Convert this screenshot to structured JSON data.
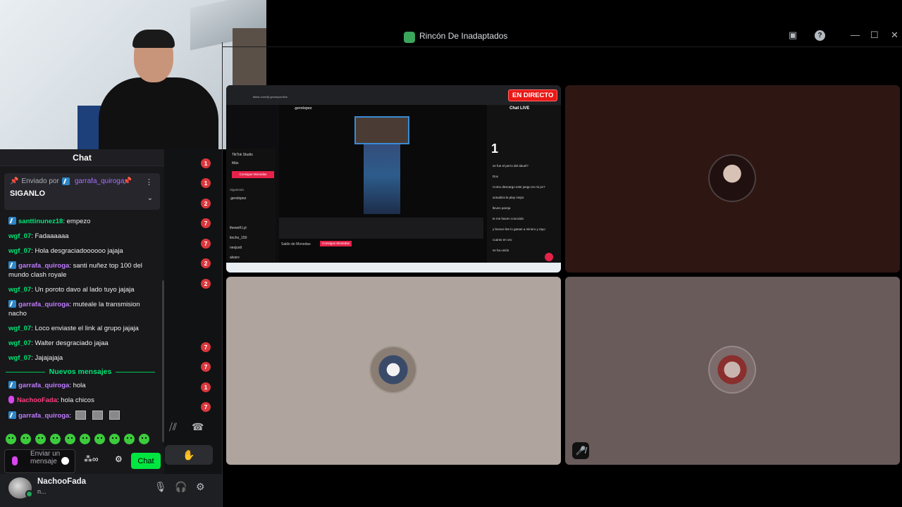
{
  "window": {
    "server_name": "Rincón De Inadaptados"
  },
  "chat": {
    "title": "Chat",
    "pinned": {
      "sent_by_label": "Enviado por",
      "user": "garrafa_quiroga",
      "message": "SIGANLO"
    },
    "messages": [
      {
        "badge": true,
        "user": "santtinunez18",
        "color": "#00e676",
        "text": ": empezo"
      },
      {
        "badge": false,
        "user": "wgf_07",
        "color": "#00e676",
        "text": ": Fadaaaaaa"
      },
      {
        "badge": false,
        "user": "wgf_07",
        "color": "#00e676",
        "text": ": Hola desgraciadoooooo jajaja"
      },
      {
        "badge": true,
        "user": "garrafa_quiroga",
        "color": "#bf7bff",
        "text": ": santi nuñez top 100 del mundo clash royale"
      },
      {
        "badge": false,
        "user": "wgf_07",
        "color": "#00e676",
        "text": ": Un poroto davo al lado tuyo jajaja"
      },
      {
        "badge": true,
        "user": "garrafa_quiroga",
        "color": "#bf7bff",
        "text": ": muteale la transmision nacho"
      },
      {
        "badge": false,
        "user": "wgf_07",
        "color": "#00e676",
        "text": ": Loco enviaste el link al grupo jajaja"
      },
      {
        "badge": false,
        "user": "wgf_07",
        "color": "#00e676",
        "text": ": Walter desgraciado jajaa"
      },
      {
        "badge": false,
        "user": "wgf_07",
        "color": "#00e676",
        "text": ": Jajajajaja"
      }
    ],
    "new_messages_label": "Nuevos mensajes",
    "new_messages": [
      {
        "badge": "pin",
        "user": "garrafa_quiroga",
        "color": "#bf7bff",
        "text": ": hola"
      },
      {
        "badge": "mic",
        "user": "NachooFada",
        "color": "#ff3d7f",
        "text": ": hola chicos"
      },
      {
        "badge": "pin",
        "user": "garrafa_quiroga",
        "color": "#bf7bff",
        "text": ":"
      }
    ],
    "input_placeholder": "Enviar un mensaje",
    "send_button": "Chat"
  },
  "voice_counts": [
    "1",
    "1",
    "2",
    "7",
    "7",
    "2",
    "2",
    "7",
    "7",
    "1",
    "7"
  ],
  "user": {
    "name": "NachooFada",
    "status": "n..."
  },
  "stream": {
    "live_badge": "EN DIRECTO",
    "url_text": "tiktok.com/@.gerolopez/live",
    "studio_label": "TikTok Studio",
    "more_label": "Más",
    "cta_label": "Consigue Monedas",
    "following_label": "Siguiendo",
    "channels": [
      ".gerolopez",
      "thewolf.Lyt",
      "tincho_150",
      "nexjusti",
      "alvaro"
    ],
    "streamer": ".gerolopez",
    "chat_title": "Chat LIVE",
    "rank": "1",
    "chat_lines": [
      "se fue el perro del abuel?",
      "Dox",
      "Como descargo este juego en mi pc?",
      "actualiza la play mejor",
      "lleves pareja",
      "te me hacen conocido",
      "y leonce kte lo ganan a minero y rayo",
      "cuanto en oro",
      "se ha unido"
    ],
    "coins_label": "Saldo de Monedas",
    "coins_button": "Consigue Monedas"
  },
  "colors": {
    "accent": "#00e640",
    "badge_red": "#da373c",
    "live_red": "#e91916"
  }
}
